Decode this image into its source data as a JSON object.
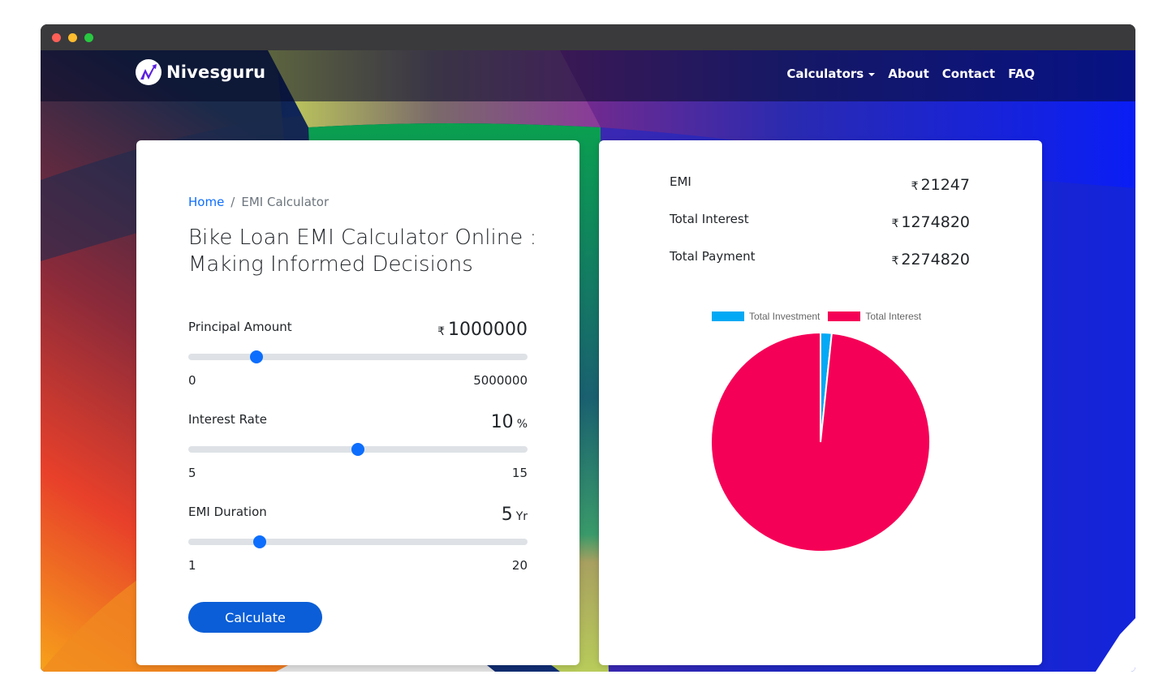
{
  "window": {
    "controls": [
      "close",
      "minimize",
      "maximize"
    ]
  },
  "navbar": {
    "brand": "Nivesguru",
    "logo_icon": "nivesguru-logo-icon",
    "items": [
      {
        "label": "Calculators",
        "has_dropdown": true
      },
      {
        "label": "About"
      },
      {
        "label": "Contact"
      },
      {
        "label": "FAQ"
      }
    ]
  },
  "breadcrumb": {
    "home": "Home",
    "separator": "/",
    "current": "EMI Calculator"
  },
  "page_title": "Bike Loan EMI Calculator Online : Making Informed Decisions",
  "fields": {
    "principal": {
      "label": "Principal Amount",
      "currency": "₹",
      "value": "1000000",
      "unit": "",
      "min": "0",
      "max": "5000000",
      "fraction": 0.2
    },
    "interest": {
      "label": "Interest Rate",
      "currency": "",
      "value": "10",
      "unit": "%",
      "min": "5",
      "max": "15",
      "fraction": 0.5
    },
    "duration": {
      "label": "EMI Duration",
      "currency": "",
      "value": "5",
      "unit": "Yr",
      "min": "1",
      "max": "20",
      "fraction": 0.2105
    }
  },
  "calculate_label": "Calculate",
  "results": {
    "currency": "₹",
    "emi": {
      "label": "EMI",
      "value": "21247"
    },
    "total_interest": {
      "label": "Total Interest",
      "value": "1274820"
    },
    "total_payment": {
      "label": "Total Payment",
      "value": "2274820"
    }
  },
  "colors": {
    "accent": "#0d6efd",
    "button": "#0b5ed7",
    "investment": "#03a9f4",
    "interest": "#f50057"
  },
  "chart_data": {
    "type": "pie",
    "title": "",
    "legend_position": "top",
    "labels": [
      "Total Investment",
      "Total Interest"
    ],
    "values": [
      21247,
      1274820
    ],
    "colors": [
      "#03a9f4",
      "#f50057"
    ]
  }
}
